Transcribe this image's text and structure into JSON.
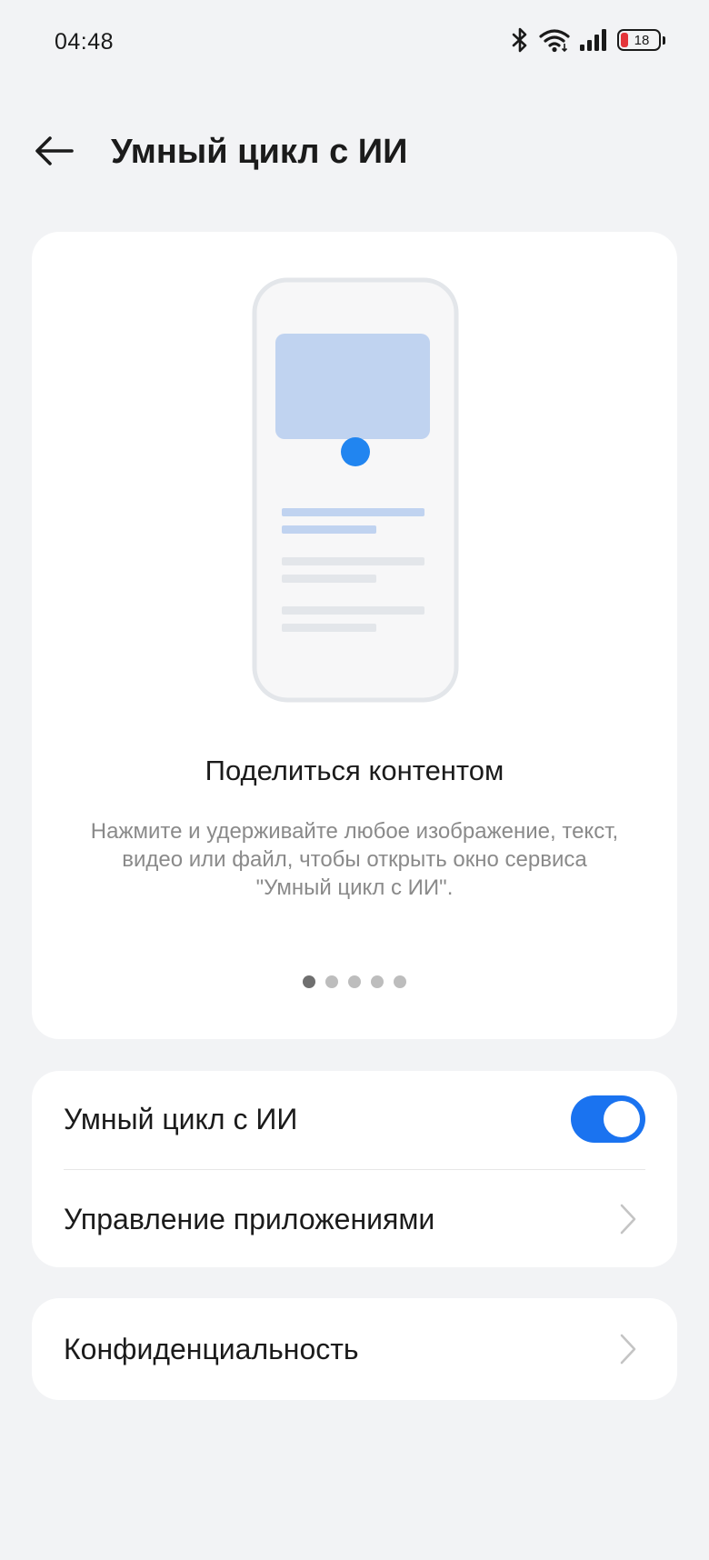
{
  "status_bar": {
    "time": "04:48",
    "battery_level": "18",
    "icons": [
      "bluetooth-icon",
      "wifi-icon",
      "signal-icon",
      "battery-icon"
    ]
  },
  "header": {
    "title": "Умный цикл с ИИ",
    "back_icon": "arrow-left-icon"
  },
  "promo": {
    "title": "Поделиться контентом",
    "description": "Нажмите и удерживайте любое изображение, текст, видео или файл, чтобы открыть окно сервиса \"Умный цикл с ИИ\".",
    "page_count": 5,
    "active_page": 1
  },
  "settings": {
    "smart_cycle_label": "Умный цикл с ИИ",
    "smart_cycle_enabled": true,
    "app_management_label": "Управление приложениями"
  },
  "privacy": {
    "label": "Конфиденциальность"
  },
  "colors": {
    "background": "#f2f3f5",
    "card": "#ffffff",
    "accent": "#1a73f0",
    "illustration_block": "#c0d3f0",
    "muted_text": "#8a8a8a"
  }
}
